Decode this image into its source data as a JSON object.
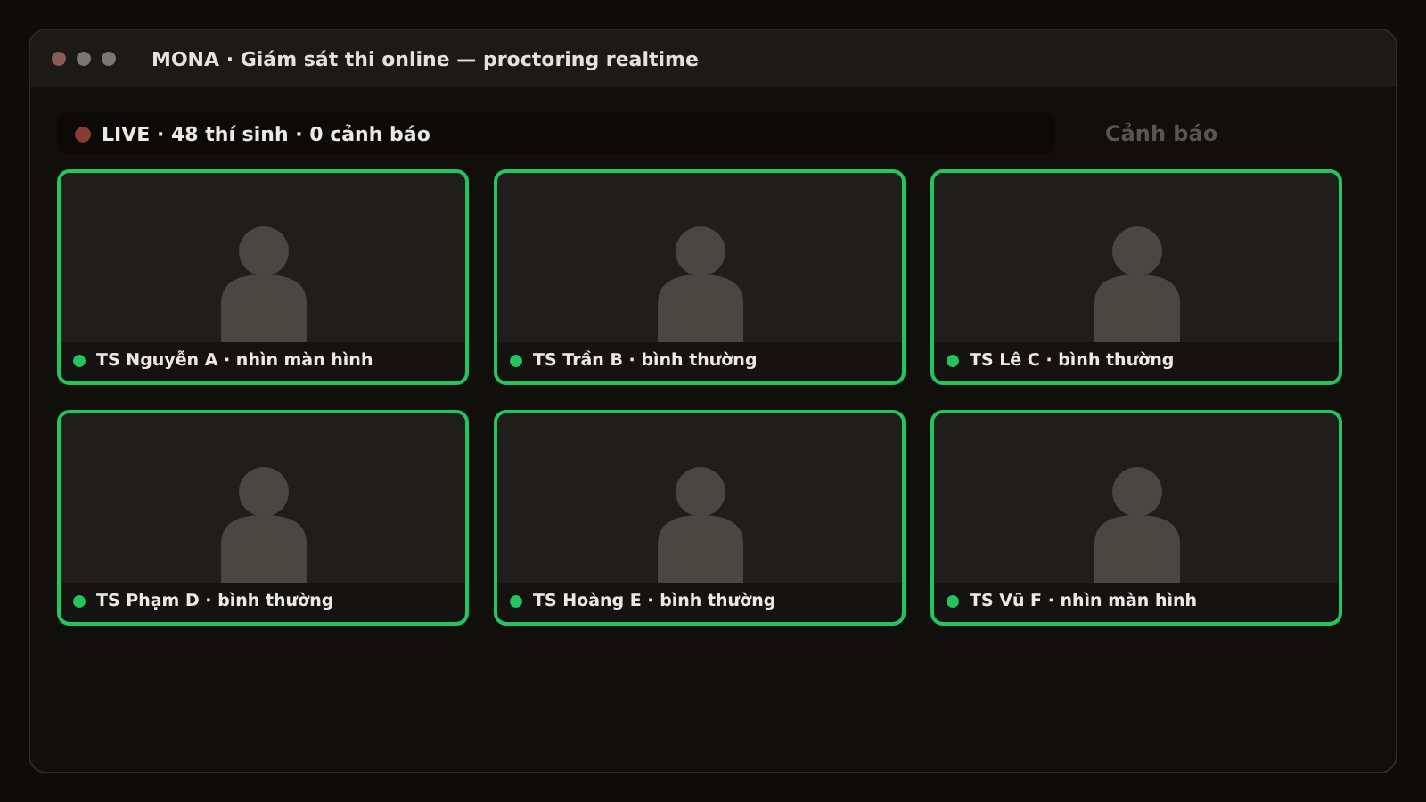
{
  "window": {
    "title": "MONA · Giám sát thi online — proctoring realtime"
  },
  "status": {
    "live": true,
    "text": "LIVE · 48 thí sinh · 0 cảnh báo"
  },
  "side_label": "Cảnh báo",
  "candidates": [
    {
      "label": "TS Nguyễn A · nhìn màn hình",
      "online": true
    },
    {
      "label": "TS Trần B · bình thường",
      "online": true
    },
    {
      "label": "TS Lê C · bình thường",
      "online": true
    },
    {
      "label": "TS Phạm D · bình thường",
      "online": true
    },
    {
      "label": "TS Hoàng E · bình thường",
      "online": true
    },
    {
      "label": "TS Vũ F · nhìn màn hình",
      "online": true
    }
  ]
}
